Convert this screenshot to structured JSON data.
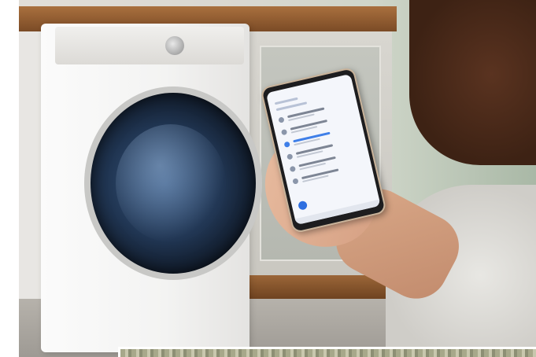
{
  "scene": {
    "subjects": [
      "washing-machine",
      "smartphone",
      "hand",
      "cabinet"
    ],
    "colors": {
      "washer_body": "#f3f3f2",
      "door_glass": "#203552",
      "cabinet_wood": "#8a5a30",
      "phone_accent": "#3f7fe8",
      "hair": "#4a2a18"
    }
  }
}
